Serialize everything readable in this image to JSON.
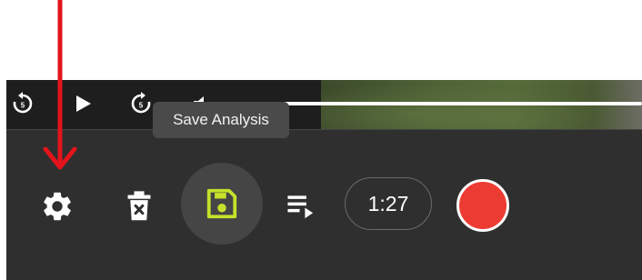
{
  "video_controls": {
    "rewind_icon": "replay-5-icon",
    "play_icon": "play-icon",
    "forward_icon": "forward-5-icon",
    "volume_icon": "volume-icon",
    "rewind_seconds": "5",
    "forward_seconds": "5"
  },
  "tooltip": {
    "text": "Save Analysis"
  },
  "toolbar": {
    "settings_icon": "gear-icon",
    "delete_icon": "trash-icon",
    "save_icon": "floppy-disk-icon",
    "playlist_icon": "playlist-play-icon",
    "timer": "1:27",
    "record_icon": "record-icon"
  },
  "colors": {
    "accent_save": "#c6e12a",
    "record": "#ec3b33",
    "annotation_arrow": "#e3141b",
    "toolbar_bg": "#2f2f2f"
  }
}
